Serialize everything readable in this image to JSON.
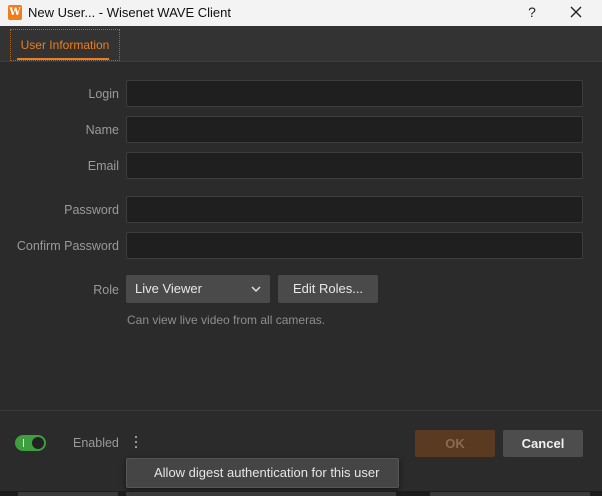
{
  "window": {
    "title": "New User... - Wisenet WAVE Client",
    "app_icon_letter": "W",
    "help_icon": "?",
    "close_icon": "close-icon"
  },
  "tabs": [
    {
      "label": "User Information",
      "active": true
    }
  ],
  "form": {
    "login": {
      "label": "Login",
      "value": ""
    },
    "name": {
      "label": "Name",
      "value": ""
    },
    "email": {
      "label": "Email",
      "value": ""
    },
    "password": {
      "label": "Password",
      "value": ""
    },
    "confirm_password": {
      "label": "Confirm Password",
      "value": ""
    },
    "role": {
      "label": "Role",
      "selected": "Live Viewer",
      "edit_button": "Edit Roles...",
      "description": "Can view live video from all cameras."
    }
  },
  "footer": {
    "enabled_label": "Enabled",
    "enabled": true,
    "ok_label": "OK",
    "cancel_label": "Cancel"
  },
  "popup_menu": {
    "items": [
      "Allow digest authentication for this user"
    ]
  },
  "colors": {
    "accent": "#f07d19",
    "toggle_on": "#3d9f3d",
    "background": "#2b2b2b"
  }
}
